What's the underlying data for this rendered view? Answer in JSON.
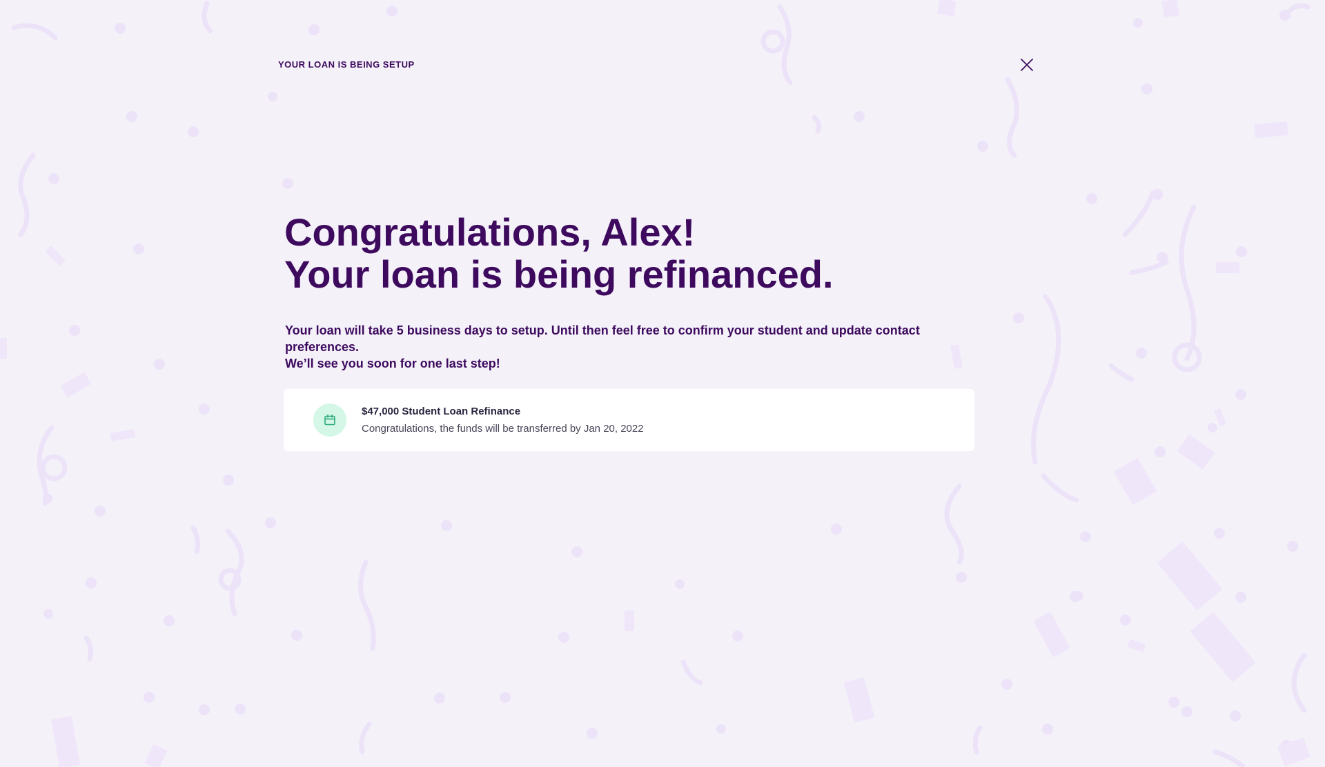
{
  "header": {
    "label": "YOUR LOAN IS BEING SETUP"
  },
  "headline": {
    "line1": "Congratulations, Alex!",
    "line2": "Your loan is being refinanced."
  },
  "description": {
    "line1": "Your loan will take 5 business days to setup. Until then feel free to confirm your student and update contact preferences.",
    "line2": "We’ll see you soon for one last step!"
  },
  "loan_card": {
    "icon": "calendar-icon",
    "title": "$47,000 Student Loan Refinance",
    "subtitle": "Congratulations, the funds will be transferred by Jan 20, 2022"
  },
  "colors": {
    "background": "#f4f1f9",
    "primary_text": "#3d0a5e",
    "confetti": "#e9dff7",
    "icon_background": "#d4f7e8",
    "icon_color": "#2faa7a"
  }
}
